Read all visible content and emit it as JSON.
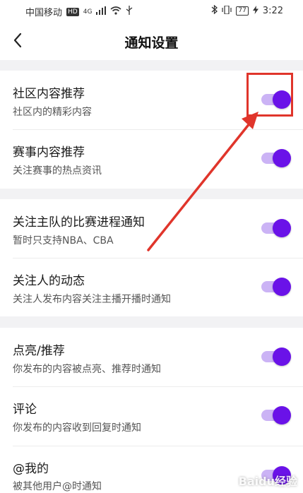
{
  "status": {
    "carrier": "中国移动",
    "hd": "HD",
    "net": "4G",
    "battery": "77",
    "time": "3:22"
  },
  "header": {
    "title": "通知设置"
  },
  "items": [
    {
      "label": "社区内容推荐",
      "desc": "社区内的精彩内容",
      "on": true
    },
    {
      "label": "赛事内容推荐",
      "desc": "关注赛事的热点资讯",
      "on": true
    },
    {
      "label": "关注主队的比赛进程通知",
      "desc": "暂时只支持NBA、CBA",
      "on": true
    },
    {
      "label": "关注人的动态",
      "desc": "关注人发布内容关注主播开播时通知",
      "on": true
    },
    {
      "label": "点亮/推荐",
      "desc": "你发布的内容被点亮、推荐时通知",
      "on": true
    },
    {
      "label": "评论",
      "desc": "你发布的内容收到回复时通知",
      "on": true
    },
    {
      "label": "@我的",
      "desc": "被其他用户@时通知",
      "on": true
    }
  ],
  "colors": {
    "accent": "#6a12e8",
    "track": "#cbb3f5",
    "highlight": "#e0352b"
  },
  "watermark": "Baidu经验"
}
